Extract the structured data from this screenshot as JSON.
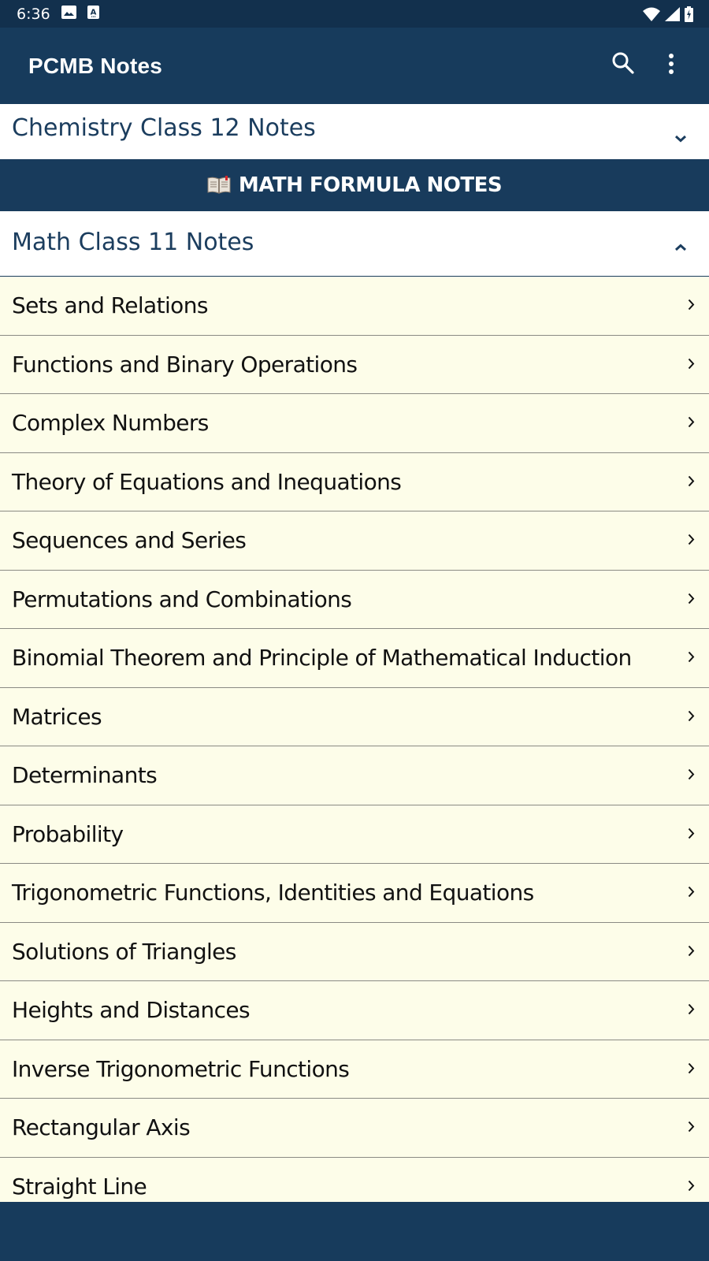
{
  "status_bar": {
    "time": "6:36",
    "left_icons": [
      "image-notification-icon",
      "text-notification-icon"
    ],
    "right_icons": [
      "wifi-icon",
      "cell-signal-icon",
      "battery-charging-icon"
    ]
  },
  "app_bar": {
    "title": "PCMB Notes",
    "actions": [
      "search-icon",
      "more-vert-icon"
    ]
  },
  "colors": {
    "primary": "#173b5c",
    "status_bar": "#12304d",
    "list_background": "#fdfde9",
    "header_text": "#1b3d5e"
  },
  "sections": {
    "chemistry": {
      "label": "Chemistry Class 12 Notes",
      "expanded": false
    },
    "banner": {
      "icon": "open-book-icon",
      "label": "MATH FORMULA NOTES"
    },
    "math": {
      "label": "Math Class 11 Notes",
      "expanded": true
    }
  },
  "topics": [
    {
      "label": "Sets and Relations"
    },
    {
      "label": "Functions and Binary Operations"
    },
    {
      "label": "Complex Numbers"
    },
    {
      "label": "Theory of Equations and Inequations"
    },
    {
      "label": "Sequences and Series"
    },
    {
      "label": "Permutations and Combinations"
    },
    {
      "label": "Binomial Theorem and Principle of Mathematical Induction"
    },
    {
      "label": "Matrices"
    },
    {
      "label": "Determinants"
    },
    {
      "label": "Probability"
    },
    {
      "label": "Trigonometric Functions, Identities and Equations"
    },
    {
      "label": "Solutions of Triangles"
    },
    {
      "label": "Heights and Distances"
    },
    {
      "label": "Inverse Trigonometric Functions"
    },
    {
      "label": "Rectangular Axis"
    },
    {
      "label": "Straight Line"
    }
  ]
}
